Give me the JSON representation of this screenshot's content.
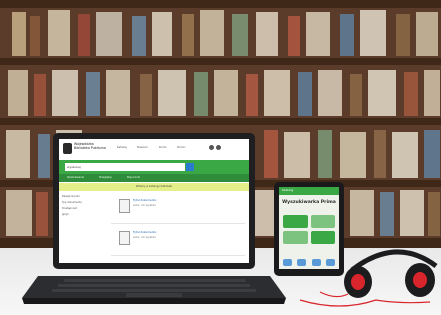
{
  "laptop": {
    "brand": "Wojewódzka Biblioteka Publiczna",
    "nav": [
      "Katalog",
      "Nowości",
      "Konto",
      "Pomoc"
    ],
    "search_value": "wyszukaj",
    "tabs": [
      "Wyszukiwanie",
      "Przeglądaj",
      "Moje konto"
    ],
    "notice": "Witamy w katalogu biblioteki",
    "sidebar": [
      "Zawęź wyniki",
      "Typ dokumentu",
      "Dostępność",
      "Język"
    ],
    "results": [
      {
        "title": "Tytuł dokumentu",
        "meta": "Autor, rok wydania"
      },
      {
        "title": "Tytuł dokumentu",
        "meta": "Autor, rok wydania"
      }
    ]
  },
  "tablet": {
    "top_label": "Katalog",
    "title": "Wyszukiwarka Prima"
  },
  "colors": {
    "accent_green": "#3aa845",
    "notice_yellow": "#e3f08a",
    "headphone_red": "#d9262c"
  }
}
